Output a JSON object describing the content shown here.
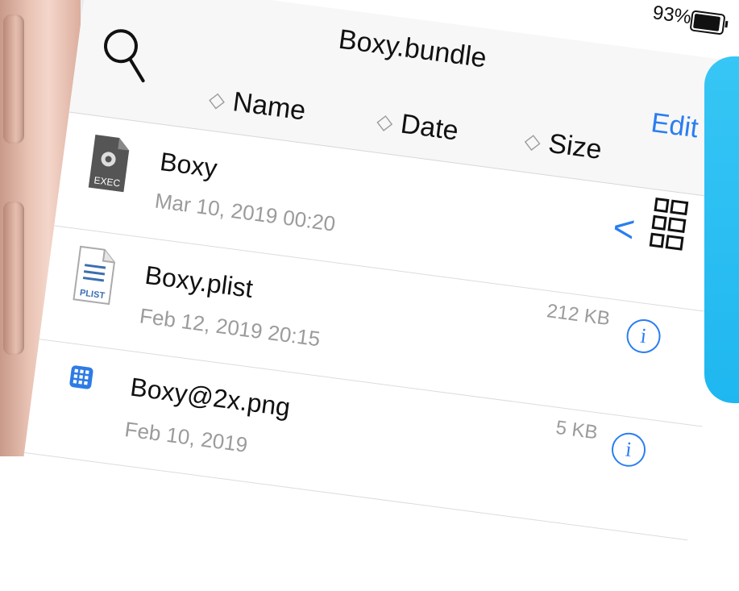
{
  "status_bar": {
    "battery_percent": "93%",
    "battery_level": 0.93
  },
  "nav": {
    "title": "Boxy.bundle",
    "edit_label": "Edit",
    "search_icon": "search-icon"
  },
  "sort": {
    "name_label": "Name",
    "date_label": "Date",
    "size_label": "Size",
    "chevron_glyph": "◇"
  },
  "controls": {
    "back_glyph": "<",
    "view_icon": "list-grid-icon"
  },
  "files": [
    {
      "name": "Boxy",
      "date": "Mar 10, 2019 00:20",
      "size": "",
      "icon": "exec-file-icon",
      "icon_label": "EXEC"
    },
    {
      "name": "Boxy.plist",
      "date": "Feb 12, 2019 20:15",
      "size": "212 KB",
      "icon": "plist-file-icon",
      "icon_label": "PLIST"
    },
    {
      "name": "Boxy@2x.png",
      "date": "Feb 10, 2019",
      "size": "5 KB",
      "icon": "png-file-icon",
      "icon_label": ""
    }
  ],
  "info_glyph": "i",
  "colors": {
    "accent": "#2a7ef0",
    "side_panel": "#2ab9f2",
    "phone_body": "#e8c2b3"
  }
}
